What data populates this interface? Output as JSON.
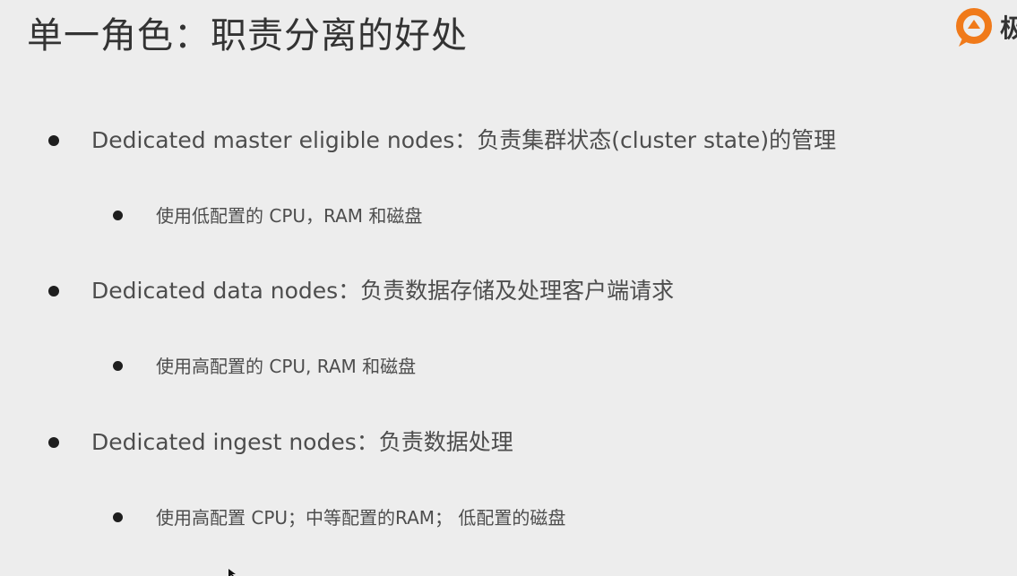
{
  "slide": {
    "title": "单一角色：职责分离的好处",
    "logo": {
      "text": "极",
      "icon": "orange-q-logo-icon",
      "accent_color": "#f07a1a"
    },
    "bullets": [
      {
        "text": "Dedicated master eligible nodes：负责集群状态(cluster state)的管理",
        "sub": "使用低配置的 CPU，RAM 和磁盘"
      },
      {
        "text": "Dedicated data nodes：负责数据存储及处理客户端请求",
        "sub": "使用高配置的 CPU, RAM 和磁盘"
      },
      {
        "text": "Dedicated ingest nodes：负责数据处理",
        "sub": "使用高配置 CPU；中等配置的RAM；  低配置的磁盘"
      }
    ]
  }
}
